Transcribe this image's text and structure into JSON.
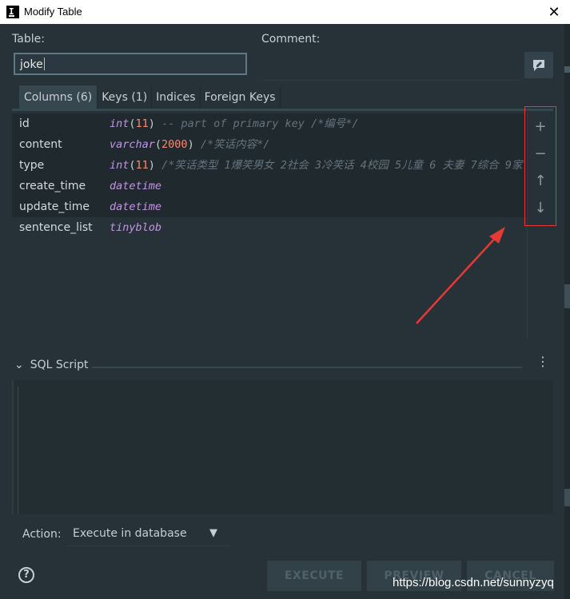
{
  "window": {
    "app_icon_letter": "I",
    "title": "Modify Table",
    "close_glyph": "✕"
  },
  "form": {
    "table_label": "Table:",
    "table_value": "joke",
    "comment_label": "Comment:",
    "comment_value": ""
  },
  "tabs": [
    {
      "label": "Columns (6)",
      "active": true
    },
    {
      "label": "Keys (1)",
      "active": false
    },
    {
      "label": "Indices",
      "active": false
    },
    {
      "label": "Foreign Keys",
      "active": false
    }
  ],
  "columns": [
    {
      "name": "id",
      "type": "int",
      "size": "11",
      "comment": "-- part of primary key /*编号*/"
    },
    {
      "name": "content",
      "type": "varchar",
      "size": "2000",
      "comment": "/*笑话内容*/"
    },
    {
      "name": "type",
      "type": "int",
      "size": "11",
      "comment": "/*笑话类型 1爆笑男女 2社会 3冷笑话 4校园 5儿童 6 夫妻 7综合 9家"
    },
    {
      "name": "create_time",
      "type": "datetime",
      "size": "",
      "comment": ""
    },
    {
      "name": "update_time",
      "type": "datetime",
      "size": "",
      "comment": ""
    },
    {
      "name": "sentence_list",
      "type": "tinyblob",
      "size": "",
      "comment": ""
    }
  ],
  "column_actions": {
    "add": "+",
    "remove": "−",
    "move_up": "↑",
    "move_down": "↓"
  },
  "sql_script": {
    "label": "SQL Script",
    "content": ""
  },
  "action": {
    "label": "Action:",
    "value": "Execute in database"
  },
  "buttons": {
    "execute": "EXECUTE",
    "preview": "PREVIEW",
    "cancel": "CANCEL",
    "help": "?"
  },
  "watermark": "https://blog.csdn.net/sunnyzyq",
  "colors": {
    "background": "#263238",
    "keyword": "#c792ea",
    "number": "#f78c6c",
    "comment": "#65737e",
    "annotation": "#e53935"
  }
}
